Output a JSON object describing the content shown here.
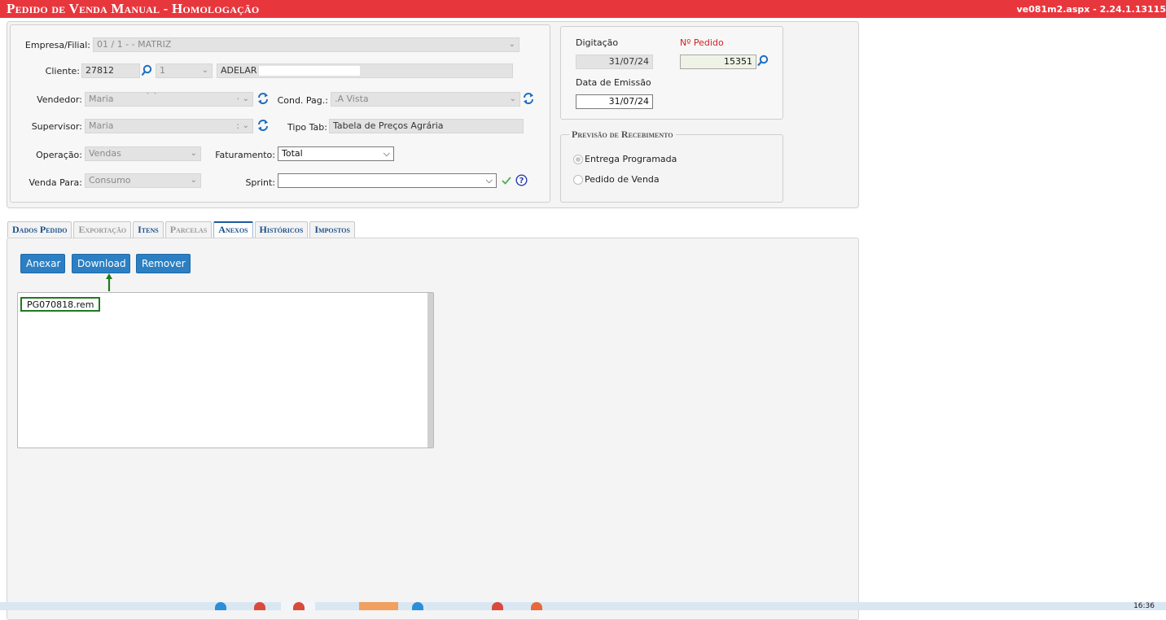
{
  "header": {
    "title": "Pedido de Venda Manual  - Homologação",
    "version": "ve081m2.aspx - 2.24.1.13115"
  },
  "form": {
    "empresa": {
      "label": "Empresa/Filial:",
      "value": "01 / 1 -                   - MATRIZ"
    },
    "cliente": {
      "label": "Cliente:",
      "code": "27812",
      "seq": "1",
      "name": "ADELAR"
    },
    "vendedor": {
      "label": "Vendedor:",
      "value": "Maria",
      "suffix": "` `",
      "tail": "·"
    },
    "cond_pag": {
      "label": "Cond. Pag.:",
      "value": ".A Vista"
    },
    "supervisor": {
      "label": "Supervisor:",
      "value": "Maria",
      "tail": ":"
    },
    "tipo_tab": {
      "label": "Tipo Tab:",
      "value": "Tabela de Preços Agrária"
    },
    "operacao": {
      "label": "Operação:",
      "value": "Vendas"
    },
    "faturamento": {
      "label": "Faturamento:",
      "value": "Total"
    },
    "venda_para": {
      "label": "Venda Para:",
      "value": "Consumo"
    },
    "sprint": {
      "label": "Sprint:",
      "value": ""
    }
  },
  "side": {
    "digitacao_label": "Digitação",
    "digitacao_value": "31/07/24",
    "pedido_label": "Nº Pedido",
    "pedido_value": "15351",
    "emissao_label": "Data de Emissão",
    "emissao_value": "31/07/24",
    "previsao_legend": "Previsão de Recebimento",
    "options": [
      {
        "label": "Entrega Programada",
        "checked": true
      },
      {
        "label": "Pedido de Venda",
        "checked": false
      }
    ]
  },
  "tabs": [
    {
      "label": "Dados Pedido",
      "state": "normal"
    },
    {
      "label": "Exportação",
      "state": "disabled"
    },
    {
      "label": "Itens",
      "state": "normal"
    },
    {
      "label": "Parcelas",
      "state": "disabled"
    },
    {
      "label": "Anexos",
      "state": "active"
    },
    {
      "label": "Históricos",
      "state": "normal"
    },
    {
      "label": "Impostos",
      "state": "normal"
    }
  ],
  "anexos": {
    "buttons": {
      "anexar": "Anexar",
      "download": "Download",
      "remover": "Remover"
    },
    "files": [
      "PG070818.rem"
    ]
  },
  "taskbar": {
    "clock": "16:36"
  },
  "colors": {
    "title_bg": "#e8363d",
    "button": "#2b7fc2",
    "highlight": "#1f7a1f",
    "pedido_label": "#d42020"
  }
}
